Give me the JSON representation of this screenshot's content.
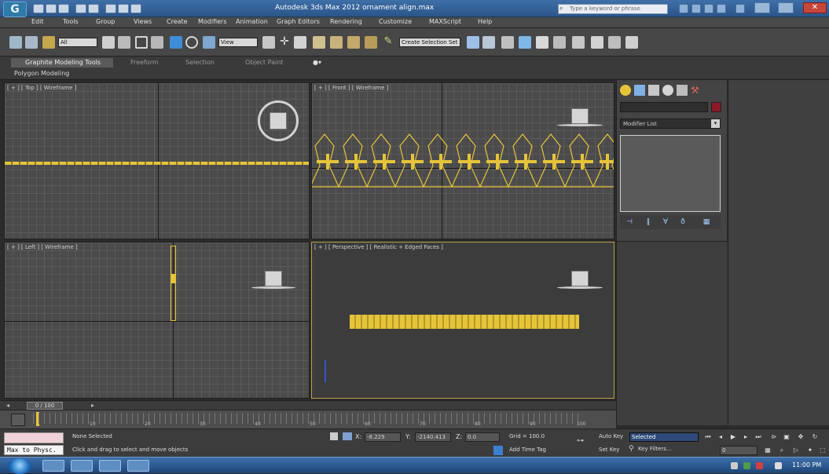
{
  "window": {
    "app_logo": "G",
    "title": "Autodesk 3ds Max 2012    ornament align.max",
    "search_placeholder": "Type a keyword or phrase",
    "close_glyph": "✕"
  },
  "menu": [
    "Edit",
    "Tools",
    "Group",
    "Views",
    "Create",
    "Modifiers",
    "Animation",
    "Graph Editors",
    "Rendering",
    "Customize",
    "MAXScript",
    "Help"
  ],
  "toolbar": {
    "selection_filter": "All",
    "ref_coord": "View",
    "named_sel": "Create Selection Set"
  },
  "ribbon": {
    "tabs": [
      "Graphite Modeling Tools",
      "Freeform",
      "Selection",
      "Object Paint"
    ],
    "panel_label": "Polygon Modeling"
  },
  "viewports": {
    "top_label": "[ + ] [ Top ] [ Wireframe ]",
    "front_label": "[ + ] [ Front ] [ Wireframe ]",
    "left_label": "[ + ] [ Left ] [ Wireframe ]",
    "persp_label": "[ + ] [ Perspective ] [ Realistic + Edged Faces ]"
  },
  "command_panel": {
    "modifier_list": "Modifier List"
  },
  "timeline": {
    "time_slider": "0 / 100",
    "frame_numbers": [
      "0",
      "10",
      "20",
      "30",
      "40",
      "50",
      "60",
      "70",
      "80",
      "90",
      "100"
    ]
  },
  "status": {
    "maxscript_label": "Max to Physc.",
    "selection": "None Selected",
    "prompt": "Click and drag to select and move objects",
    "x_label": "X:",
    "y_label": "Y:",
    "z_label": "Z:",
    "x_value": "-8.229",
    "y_value": "-2140.413",
    "z_value": "0.0",
    "grid": "Grid = 100.0",
    "add_time_tag": "Add Time Tag",
    "auto_key": "Auto Key",
    "set_key": "Set Key",
    "selected_dropdown": "Selected",
    "key_filters": "Key Filters...",
    "frame": "0"
  },
  "taskbar": {
    "clock": "11:00 PM"
  },
  "colors": {
    "gold_objects": "#e6c43a",
    "object_color_swatch": "#8a1a28",
    "titlebar": "#3e6fa8"
  }
}
